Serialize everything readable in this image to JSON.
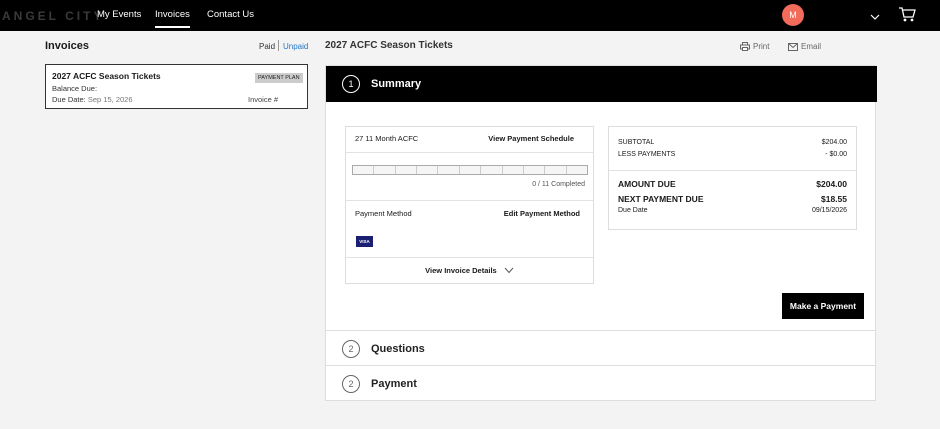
{
  "nav": {
    "logo": "ANGEL CITY",
    "items": [
      "My Events",
      "Invoices",
      "Contact Us"
    ],
    "avatar_initial": "M"
  },
  "sidebar": {
    "title": "Invoices",
    "filter_paid": "Paid",
    "filter_unpaid": "Unpaid",
    "invoice": {
      "title": "2027 ACFC Season Tickets",
      "badge": "PAYMENT PLAN",
      "balance_label": "Balance Due:",
      "due_label": "Due Date:",
      "due_value": "Sep 15, 2026",
      "invoice_label": "Invoice #"
    }
  },
  "main": {
    "title": "2027 ACFC Season Tickets",
    "print_label": "Print",
    "email_label": "Email",
    "summary": {
      "step": "1",
      "title": "Summary",
      "plan_name": "27 11 Month ACFC",
      "view_schedule": "View Payment Schedule",
      "progress_completed": 0,
      "progress_total": 11,
      "progress_text": "0 / 11 Completed",
      "payment_method_label": "Payment Method",
      "edit_payment_method": "Edit Payment Method",
      "card_brand": "VISA",
      "view_details": "View Invoice Details",
      "subtotal_label": "SUBTOTAL",
      "subtotal_value": "$204.00",
      "less_payments_label": "LESS PAYMENTS",
      "less_payments_value": "- $0.00",
      "amount_due_label": "AMOUNT DUE",
      "amount_due_value": "$204.00",
      "next_payment_label": "NEXT PAYMENT DUE",
      "next_payment_value": "$18.55",
      "due_date_label": "Due Date",
      "due_date_value": "09/15/2026",
      "make_payment": "Make a Payment"
    },
    "questions": {
      "step": "2",
      "title": "Questions"
    },
    "payment": {
      "step": "2",
      "title": "Payment"
    }
  },
  "colors": {
    "avatar": "#f26b5b",
    "link": "#2277c8",
    "header_bg": "#000000"
  }
}
